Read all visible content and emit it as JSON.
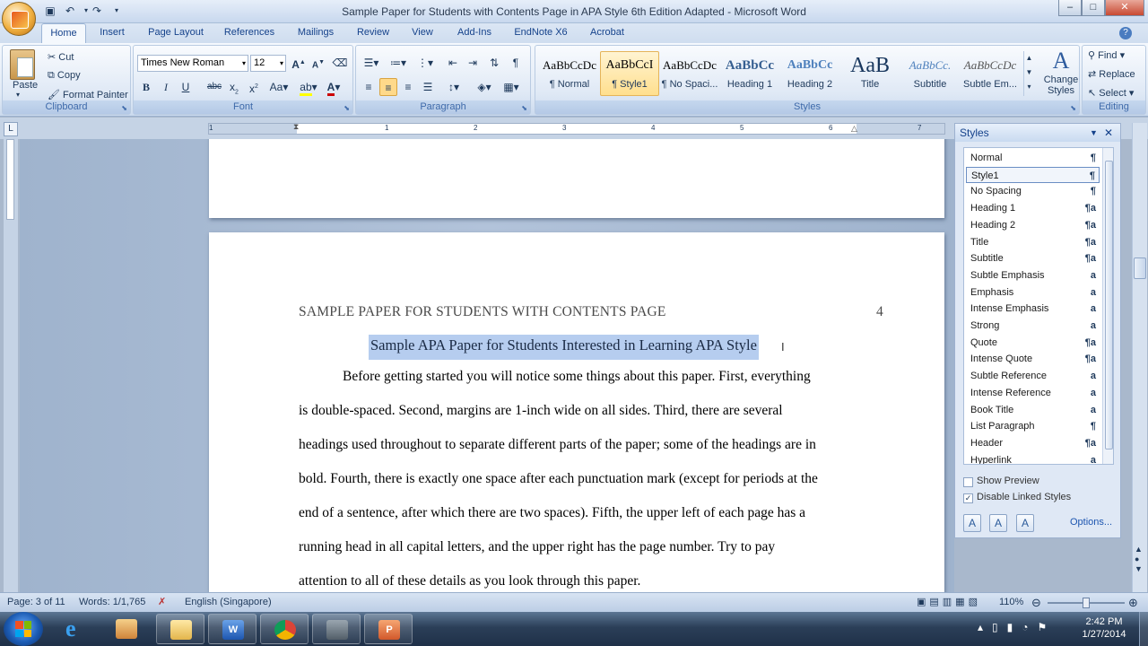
{
  "window": {
    "title": "Sample Paper for Students with Contents Page in APA Style 6th Edition Adapted - Microsoft Word",
    "controls": [
      "–",
      "□",
      "✕"
    ]
  },
  "quick_access": [
    "save-icon",
    "undo-icon",
    "redo-icon"
  ],
  "tabs": [
    "Home",
    "Insert",
    "Page Layout",
    "References",
    "Mailings",
    "Review",
    "View",
    "Add-Ins",
    "EndNote X6",
    "Acrobat"
  ],
  "clipboard": {
    "paste": "Paste",
    "cut": "Cut",
    "copy": "Copy",
    "format_painter": "Format Painter",
    "group": "Clipboard"
  },
  "font": {
    "family": "Times New Roman",
    "size": "12",
    "group": "Font",
    "accent": "#cc0000",
    "highlight": "#ffff00"
  },
  "paragraph": {
    "group": "Paragraph"
  },
  "styles_gallery": {
    "group": "Styles",
    "items": [
      {
        "preview": "AaBbCcDc",
        "name": "¶ Normal"
      },
      {
        "preview": "AaBbCcI",
        "name": "¶ Style1"
      },
      {
        "preview": "AaBbCcDc",
        "name": "¶ No Spaci..."
      },
      {
        "preview": "AaBbCc",
        "name": "Heading 1"
      },
      {
        "preview": "AaBbCc",
        "name": "Heading 2"
      },
      {
        "preview": "AaB",
        "name": "Title"
      },
      {
        "preview": "AaBbCc.",
        "name": "Subtitle"
      },
      {
        "preview": "AaBbCcDc",
        "name": "Subtle Em..."
      }
    ],
    "change_styles": "Change Styles"
  },
  "editing": {
    "find": "Find",
    "replace": "Replace",
    "select": "Select",
    "group": "Editing"
  },
  "ruler": {
    "numbers": [
      "1",
      "1",
      "2",
      "3",
      "4",
      "5",
      "6",
      "7"
    ]
  },
  "document": {
    "running_head": "SAMPLE PAPER FOR STUDENTS WITH CONTENTS PAGE",
    "page_number": "4",
    "title": "Sample APA Paper for Students Interested in Learning APA Style",
    "lines": [
      "Before getting started you will notice some things about this paper.  First, everything",
      "is double-spaced.  Second, margins are 1-inch wide on all sides.  Third, there are several",
      "headings used throughout to separate different parts of the paper; some of the headings are in",
      "bold.  Fourth, there is exactly one space after each punctuation mark (except for periods at the",
      "end of a sentence, after which there are two spaces).  Fifth, the upper left of each page has a",
      "running head in all capital letters, and the upper right has the page number.  Try to pay",
      "attention to all of these details as you look through this paper."
    ]
  },
  "styles_pane": {
    "title": "Styles",
    "items": [
      {
        "name": "Normal",
        "icon": "¶"
      },
      {
        "name": "Style1",
        "icon": "¶"
      },
      {
        "name": "No Spacing",
        "icon": "¶"
      },
      {
        "name": "Heading 1",
        "icon": "¶a"
      },
      {
        "name": "Heading 2",
        "icon": "¶a"
      },
      {
        "name": "Title",
        "icon": "¶a"
      },
      {
        "name": "Subtitle",
        "icon": "¶a"
      },
      {
        "name": "Subtle Emphasis",
        "icon": "a"
      },
      {
        "name": "Emphasis",
        "icon": "a"
      },
      {
        "name": "Intense Emphasis",
        "icon": "a"
      },
      {
        "name": "Strong",
        "icon": "a"
      },
      {
        "name": "Quote",
        "icon": "¶a"
      },
      {
        "name": "Intense Quote",
        "icon": "¶a"
      },
      {
        "name": "Subtle Reference",
        "icon": "a"
      },
      {
        "name": "Intense Reference",
        "icon": "a"
      },
      {
        "name": "Book Title",
        "icon": "a"
      },
      {
        "name": "List Paragraph",
        "icon": "¶"
      },
      {
        "name": "Header",
        "icon": "¶a"
      },
      {
        "name": "Hyperlink",
        "icon": "a"
      }
    ],
    "show_preview": "Show Preview",
    "show_preview_checked": false,
    "disable_linked": "Disable Linked Styles",
    "disable_linked_checked": true,
    "options": "Options..."
  },
  "status": {
    "page": "Page: 3 of 11",
    "words": "Words: 1/1,765",
    "language": "English (Singapore)",
    "zoom": "110%"
  },
  "taskbar": {
    "time": "2:42 PM",
    "date": "1/27/2014"
  }
}
